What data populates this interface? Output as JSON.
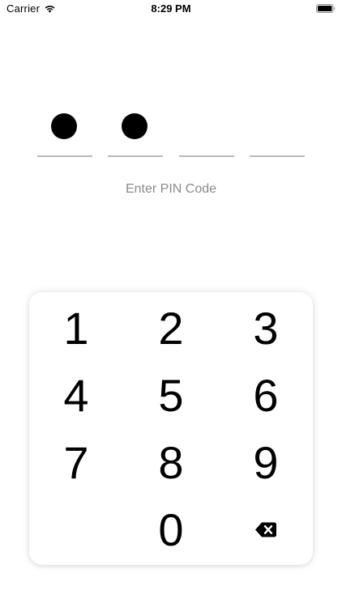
{
  "status_bar": {
    "carrier": "Carrier",
    "time": "8:29 PM",
    "icons": [
      "wifi-icon",
      "battery-icon"
    ]
  },
  "pin": {
    "length": 4,
    "filled": 2,
    "label": "Enter PIN Code"
  },
  "keypad": {
    "keys": [
      "1",
      "2",
      "3",
      "4",
      "5",
      "6",
      "7",
      "8",
      "9",
      "0"
    ],
    "delete_icon": "backspace-icon"
  },
  "colors": {
    "background": "#ffffff",
    "dot": "#000000",
    "slot_line": "#b9b9b9",
    "label": "#8a8a8a"
  }
}
